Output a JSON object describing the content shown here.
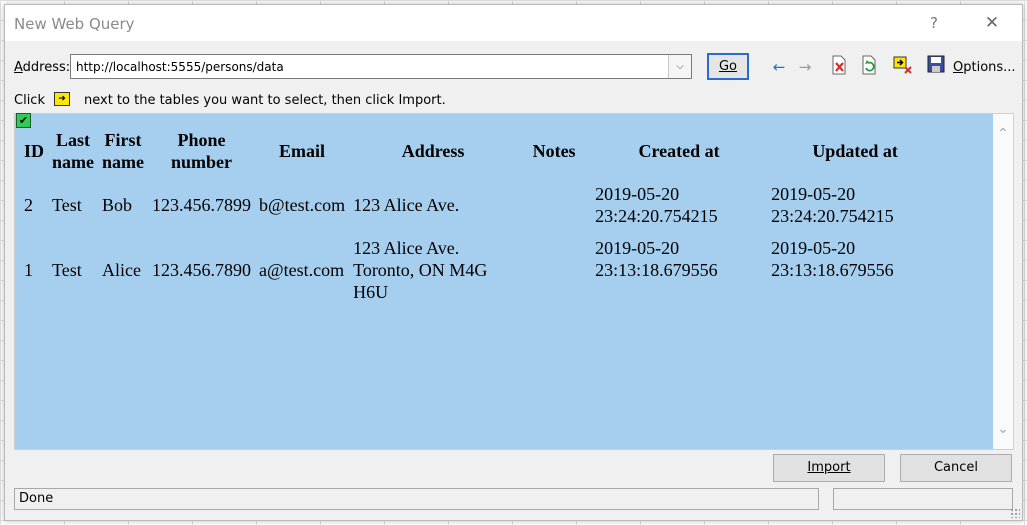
{
  "window": {
    "title": "New Web Query",
    "help": "?",
    "close": "✕"
  },
  "toolbar": {
    "address_label_prefix": "A",
    "address_label_rest": "ddress:",
    "address_value": "http://localhost:5555/persons/data",
    "go_label": "Go",
    "options_prefix": "O",
    "options_rest": "ptions..."
  },
  "hint": {
    "click": "Click",
    "rest": "next to the tables you want to select, then click Import."
  },
  "table": {
    "headers": [
      [
        "ID"
      ],
      [
        "Last",
        "name"
      ],
      [
        "First",
        "name"
      ],
      [
        "Phone",
        "number"
      ],
      [
        "Email"
      ],
      [
        "Address"
      ],
      [
        "Notes"
      ],
      [
        "Created at"
      ],
      [
        "Updated at"
      ]
    ],
    "rows": [
      {
        "id": "2",
        "last_name": "Test",
        "first_name": "Bob",
        "phone": "123.456.7899",
        "email": "b@test.com",
        "address": [
          "123 Alice Ave."
        ],
        "notes": "",
        "created_at": [
          "2019-05-20",
          "23:24:20.754215"
        ],
        "updated_at": [
          "2019-05-20",
          "23:24:20.754215"
        ]
      },
      {
        "id": "1",
        "last_name": "Test",
        "first_name": "Alice",
        "phone": "123.456.7890",
        "email": "a@test.com",
        "address": [
          "123 Alice Ave.",
          "Toronto, ON M4G",
          "H6U"
        ],
        "notes": "",
        "created_at": [
          "2019-05-20",
          "23:13:18.679556"
        ],
        "updated_at": [
          "2019-05-20",
          "23:13:18.679556"
        ]
      }
    ]
  },
  "footer": {
    "import_label": "Import",
    "cancel_label": "Cancel",
    "status_text": "Done"
  },
  "colors": {
    "content_background": "#a6cfef",
    "go_border": "#2b6bd0",
    "checkbox_green": "#2ecc55"
  },
  "icons": [
    "back-arrow-icon",
    "forward-arrow-icon",
    "stop-icon",
    "refresh-icon",
    "hide-icons-icon",
    "save-query-icon",
    "select-table-arrow-icon",
    "checkmark-icon",
    "help-icon",
    "close-icon"
  ]
}
